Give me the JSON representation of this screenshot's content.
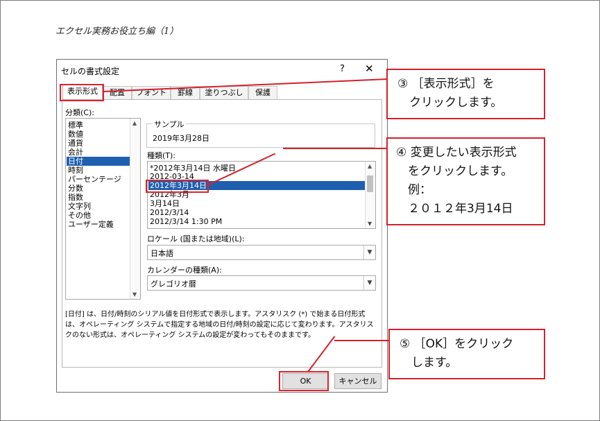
{
  "page": {
    "title": "エクセル実務お役立ち編（1）"
  },
  "dialog": {
    "title": "セルの書式設定",
    "help": "?",
    "close": "✕",
    "tabs": [
      "表示形式",
      "配置",
      "フォント",
      "罫線",
      "塗りつぶし",
      "保護"
    ],
    "category_label": "分類(C):",
    "categories": [
      "標準",
      "数値",
      "通貨",
      "会計",
      "日付",
      "時刻",
      "パーセンテージ",
      "分数",
      "指数",
      "文字列",
      "その他",
      "ユーザー定義"
    ],
    "selected_category": "日付",
    "sample_label": "サンプル",
    "sample_value": "2019年3月28日",
    "type_label": "種類(T):",
    "types": [
      "*2012年3月14日 水曜日",
      "2012-03-14",
      "2012年3月14日",
      "2012年3月",
      "3月14日",
      "2012/3/14",
      "2012/3/14 1:30 PM"
    ],
    "selected_type": "2012年3月14日",
    "locale_label": "ロケール (国または地域)(L):",
    "locale_value": "日本語",
    "calendar_label": "カレンダーの種類(A):",
    "calendar_value": "グレゴリオ暦",
    "description": "[日付] は、日付/時刻のシリアル値を日付形式で表示します。アスタリスク (*) で始まる日付形式は、オペレーティング システムで指定する地域の日付/時刻の設定に応じて変わります。アスタリスクのない形式は、オペレーティング システムの設定が変わってもそのままです。",
    "ok_label": "OK",
    "cancel_label": "キャンセル"
  },
  "callouts": {
    "step3": [
      "③ ［表示形式］を",
      "　クリックします。"
    ],
    "step4": [
      "④ 変更したい表示形式",
      "　をクリックします。",
      "　例：",
      "　２０１２年3月14日"
    ],
    "step5": [
      "⑤ ［OK］をクリック",
      "　します。"
    ]
  },
  "colors": {
    "accent_red": "#e0202a",
    "selection_blue": "#1f5fb0"
  },
  "icons": {
    "scroll_up": "chevron-up-icon",
    "scroll_down": "chevron-down-icon",
    "combo": "chevron-down-icon"
  }
}
